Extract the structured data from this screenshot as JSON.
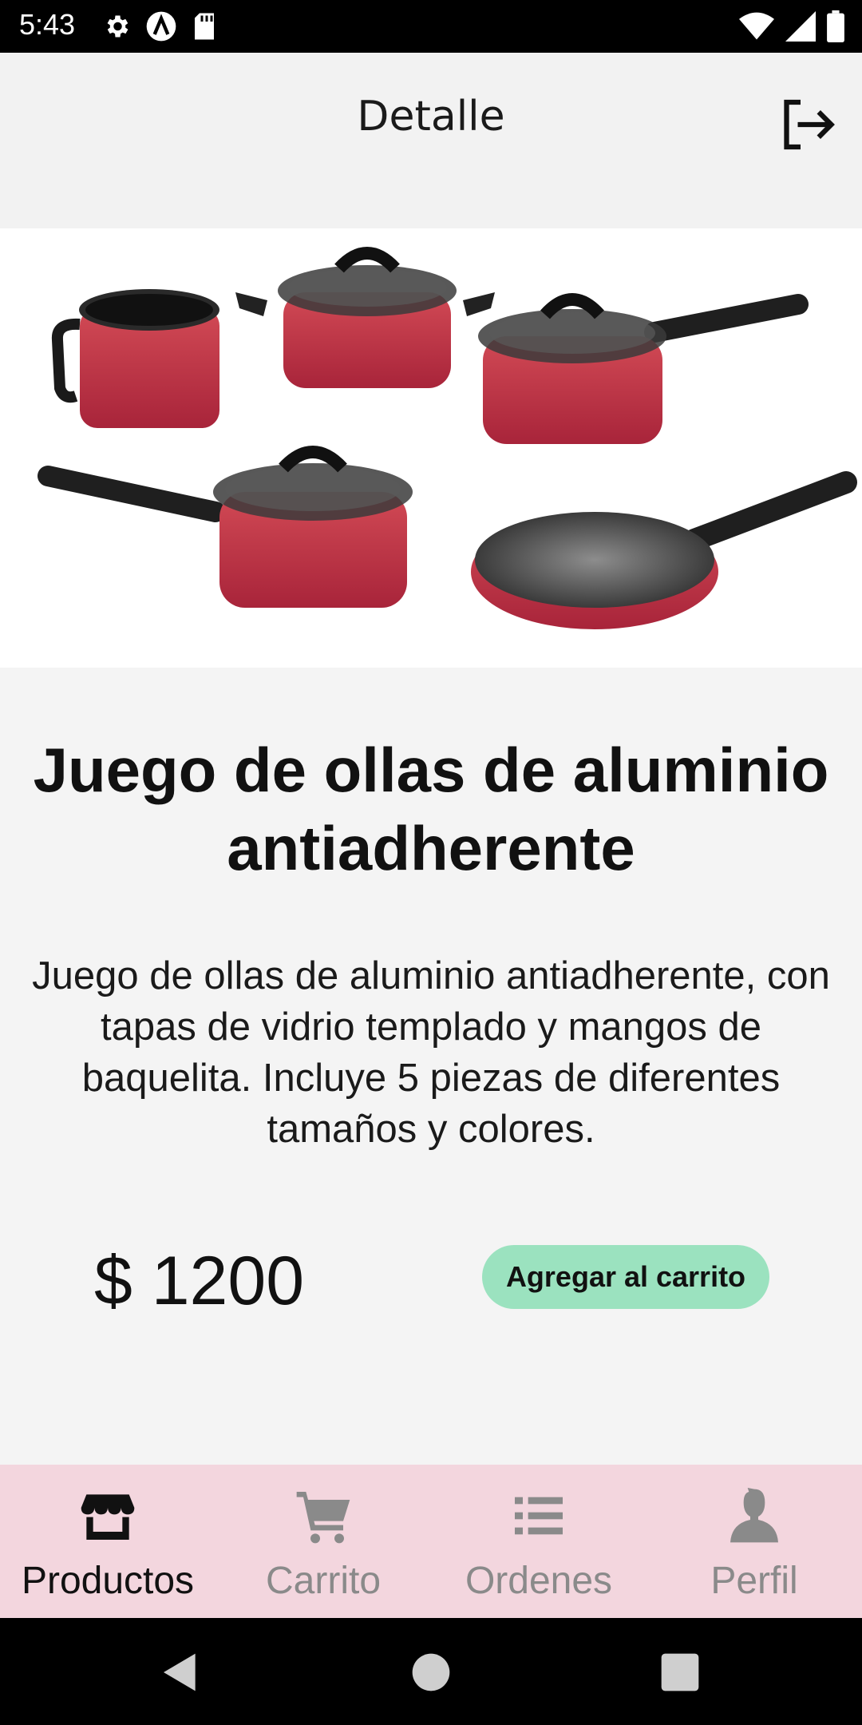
{
  "status_bar": {
    "time": "5:43",
    "icons_left": [
      "gear-icon",
      "a-circle-icon",
      "sd-card-icon"
    ],
    "icons_right": [
      "wifi-icon",
      "signal-icon",
      "battery-icon"
    ]
  },
  "header": {
    "title": "Detalle",
    "logout_icon": "logout-icon"
  },
  "product": {
    "image_description": "cookware-set-image",
    "title": "Juego de ollas de aluminio antiadherente",
    "description": "Juego de ollas de aluminio antiadherente, con tapas de vidrio templado y mangos de baquelita. Incluye 5 piezas de diferentes tamaños y colores.",
    "price": "$ 1200",
    "add_to_cart_label": "Agregar al carrito",
    "add_to_cart_color": "#9be2bf"
  },
  "bottom_nav": {
    "background": "#f3d6de",
    "items": [
      {
        "label": "Productos",
        "icon": "store-icon",
        "active": true
      },
      {
        "label": "Carrito",
        "icon": "cart-icon",
        "active": false
      },
      {
        "label": "Ordenes",
        "icon": "list-icon",
        "active": false
      },
      {
        "label": "Perfil",
        "icon": "person-icon",
        "active": false
      }
    ]
  },
  "system_nav": [
    "back-icon",
    "home-icon",
    "recents-icon"
  ]
}
